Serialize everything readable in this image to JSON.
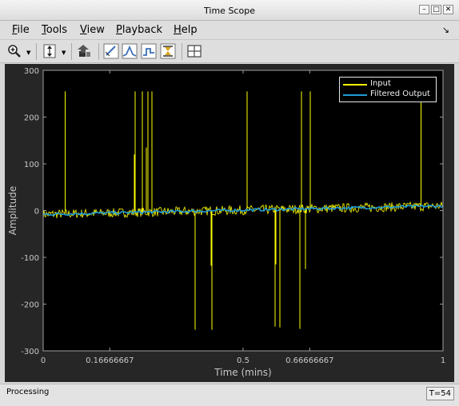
{
  "window": {
    "title": "Time Scope",
    "btn_min": "–",
    "btn_max": "□",
    "btn_close": "✕"
  },
  "menu": {
    "items": [
      "File",
      "Tools",
      "View",
      "Playback",
      "Help"
    ],
    "dock_icon": "dock-arrow-icon"
  },
  "toolbar": {
    "icons": [
      "zoom-in-icon",
      "zoom-dropdown-icon",
      "scale-axes-icon",
      "scale-dropdown-icon",
      "simulation-step-icon",
      "cursor-measurements-icon",
      "peak-finder-icon",
      "signal-statistics-icon",
      "bilevel-measurements-icon",
      "layout-icon"
    ]
  },
  "status": {
    "left": "Processing",
    "right": "T=54"
  },
  "colors": {
    "input": "#ffff00",
    "filtered": "#1e9bd7",
    "axes_bg": "#000000",
    "figure_bg": "#262626",
    "text": "#c8c8c8"
  },
  "chart_data": {
    "type": "line",
    "xlabel": "Time (mins)",
    "ylabel": "Amplitude",
    "xlim": [
      0,
      1
    ],
    "ylim": [
      -300,
      300
    ],
    "grid": false,
    "legend_position": "top-right",
    "xticks": [
      0,
      0.16666667,
      0.5,
      0.66666667,
      1
    ],
    "xtick_labels": [
      "0",
      "0.16666667",
      "0.5",
      "0.66666667",
      "1"
    ],
    "yticks": [
      -300,
      -200,
      -100,
      0,
      100,
      200,
      300
    ],
    "ytick_labels": [
      "-300",
      "-200",
      "-100",
      "0",
      "100",
      "200",
      "300"
    ],
    "series": [
      {
        "name": "Input",
        "color": "#ffff00",
        "baseline_start": -8,
        "baseline_end": 10,
        "noise_amplitude": 10,
        "spikes": [
          {
            "x": 0.055,
            "y": 255
          },
          {
            "x": 0.228,
            "y": 120
          },
          {
            "x": 0.23,
            "y": 255
          },
          {
            "x": 0.248,
            "y": 255
          },
          {
            "x": 0.258,
            "y": 135
          },
          {
            "x": 0.262,
            "y": 255
          },
          {
            "x": 0.272,
            "y": 255
          },
          {
            "x": 0.38,
            "y": -255
          },
          {
            "x": 0.42,
            "y": -118
          },
          {
            "x": 0.422,
            "y": -255
          },
          {
            "x": 0.51,
            "y": 255
          },
          {
            "x": 0.58,
            "y": -248
          },
          {
            "x": 0.582,
            "y": -115
          },
          {
            "x": 0.592,
            "y": -250
          },
          {
            "x": 0.642,
            "y": -253
          },
          {
            "x": 0.646,
            "y": 255
          },
          {
            "x": 0.656,
            "y": -125
          },
          {
            "x": 0.668,
            "y": 255
          },
          {
            "x": 0.945,
            "y": 255
          }
        ]
      },
      {
        "name": "Filtered Output",
        "color": "#1e9bd7",
        "baseline_start": -8,
        "baseline_end": 10,
        "noise_amplitude": 3
      }
    ]
  }
}
